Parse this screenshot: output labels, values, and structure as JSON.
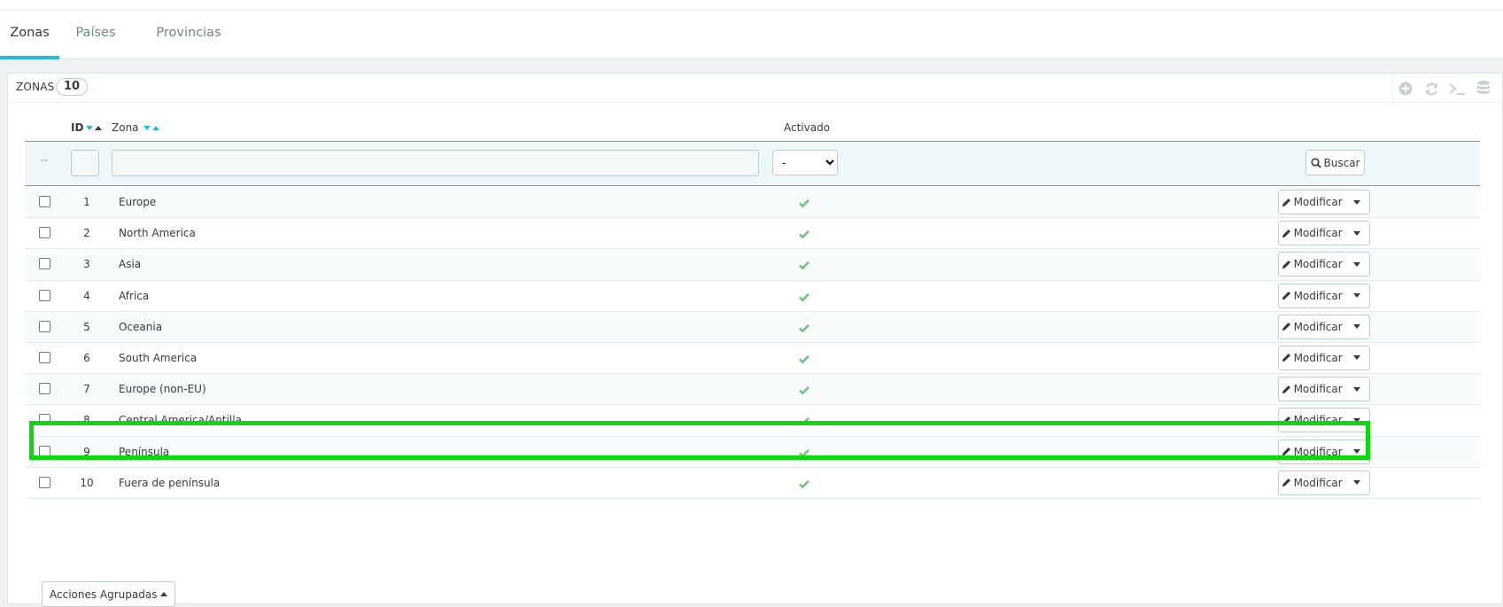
{
  "tabs": [
    {
      "label": "Zonas",
      "active": true
    },
    {
      "label": "Países",
      "active": false
    },
    {
      "label": "Provincias",
      "active": false
    }
  ],
  "panel": {
    "title": "ZONAS",
    "count": "10",
    "toolbar_icons": [
      "add-icon",
      "refresh-icon",
      "sql-terminal-icon",
      "database-icon"
    ]
  },
  "columns": {
    "id": "ID",
    "zone": "Zona",
    "enabled": "Activado"
  },
  "filters": {
    "dash": "--",
    "id_value": "",
    "zone_value": "",
    "enabled_selected": "-",
    "search_label": "Buscar"
  },
  "rows": [
    {
      "id": "1",
      "zone": "Europe",
      "enabled": true
    },
    {
      "id": "2",
      "zone": "North America",
      "enabled": true
    },
    {
      "id": "3",
      "zone": "Asia",
      "enabled": true
    },
    {
      "id": "4",
      "zone": "Africa",
      "enabled": true
    },
    {
      "id": "5",
      "zone": "Oceania",
      "enabled": true
    },
    {
      "id": "6",
      "zone": "South America",
      "enabled": true
    },
    {
      "id": "7",
      "zone": "Europe (non-EU)",
      "enabled": true
    },
    {
      "id": "8",
      "zone": "Central America/Antilla",
      "enabled": true
    },
    {
      "id": "9",
      "zone": "Península",
      "enabled": true
    },
    {
      "id": "10",
      "zone": "Fuera de península",
      "enabled": true
    }
  ],
  "row_action_label": "Modificar",
  "bulk_actions_label": "Acciones Agrupadas",
  "colors": {
    "accent": "#25b9d7",
    "check": "#72c279",
    "highlight": "#0bd90b"
  }
}
